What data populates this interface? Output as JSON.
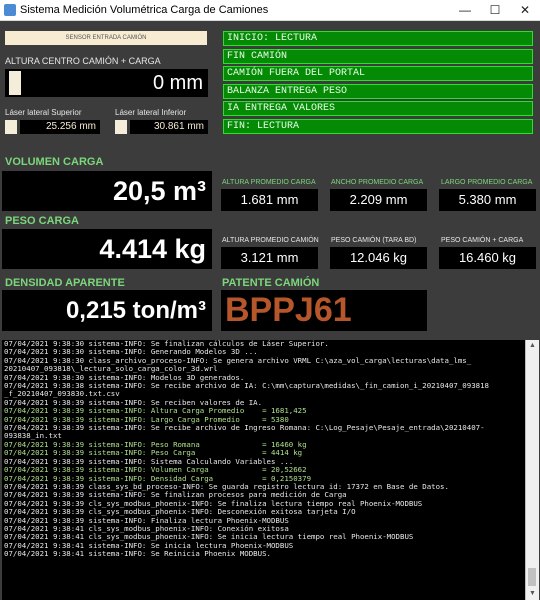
{
  "window": {
    "title": "Sistema Medición Volumétrica Carga de Camiones",
    "minimize": "—",
    "maximize": "☐",
    "close": "✕"
  },
  "sensor": {
    "entrada_label": "SENSOR ENTRADA CAMIÓN"
  },
  "altura": {
    "label": "ALTURA CENTRO CAMIÓN + CARGA",
    "value": "0 mm"
  },
  "laser": {
    "superior_label": "Láser lateral Superior",
    "superior_value": "25.256 mm",
    "inferior_label": "Láser lateral Inferior",
    "inferior_value": "30.861 mm"
  },
  "status": {
    "items": [
      "INICIO: LECTURA",
      "FIN CAMIÓN",
      "CAMIÓN FUERA DEL PORTAL",
      "BALANZA ENTREGA PESO",
      "IA ENTREGA VALORES",
      "FIN: LECTURA"
    ],
    "color": "#058a05"
  },
  "volumen": {
    "label": "VOLUMEN CARGA",
    "value": "20,5 m³"
  },
  "peso": {
    "label": "PESO CARGA",
    "value": "4.414 kg"
  },
  "densidad": {
    "label": "DENSIDAD APARENTE",
    "value": "0,215 ton/m³"
  },
  "patente": {
    "label": "PATENTE CAMIÓN",
    "value": "BPPJ61",
    "color": "#b5572b"
  },
  "metrics": {
    "altura_carga_label": "ALTURA PROMEDIO CARGA",
    "altura_carga_value": "1.681 mm",
    "ancho_carga_label": "ANCHO PROMEDIO CARGA",
    "ancho_carga_value": "2.209 mm",
    "largo_carga_label": "LARGO PROMEDIO CARGA",
    "largo_carga_value": "5.380 mm",
    "altura_camion_label": "ALTURA PROMEDIO CAMIÓN",
    "altura_camion_value": "3.121 mm",
    "peso_tara_label": "PESO CAMIÓN (TARA BD)",
    "peso_tara_value": "12.046 kg",
    "peso_total_label": "PESO CAMIÓN + CARGA",
    "peso_total_value": "16.460 kg"
  },
  "log": {
    "lines": [
      {
        "text": "07/04/2021 9:38:30 sistema-INFO: Se finalizan cálculos de Láser Superior.",
        "g": false
      },
      {
        "text": "07/04/2021 9:38:30 sistema-INFO: Generando Modelos 3D ...",
        "g": false
      },
      {
        "text": "07/04/2021 9:38:30 class_archivo_proceso-INFO: Se genera archivo VRML C:\\aza_vol_carga\\lecturas\\data_lms_",
        "g": false
      },
      {
        "text": "20210407_093818\\_lectura_solo_carga_color_3d.wrl",
        "g": false
      },
      {
        "text": "07/04/2021 9:38:30 sistema-INFO: Modelos 3D generados.",
        "g": false
      },
      {
        "text": "07/04/2021 9:38:38 sistema-INFO: Se recibe archivo de IA: C:\\mm\\captura\\medidas\\_fin_camion_i_20210407_093818",
        "g": false
      },
      {
        "text": "_f_20210407_093830.txt.csv",
        "g": false
      },
      {
        "text": "07/04/2021 9:38:39 sistema-INFO: Se reciben valores de IA.",
        "g": false
      },
      {
        "text": "07/04/2021 9:38:39 sistema-INFO: Altura Carga Promedio    = 1681,425",
        "g": true
      },
      {
        "text": "07/04/2021 9:38:39 sistema-INFO: Largo Carga Promedio     = 5380",
        "g": true
      },
      {
        "text": "07/04/2021 9:38:39 sistema-INFO: Se recibe archivo de Ingreso Romana: C:\\Log_Pesaje\\Pesaje_entrada\\20210407-",
        "g": false
      },
      {
        "text": "093838_in.txt",
        "g": false
      },
      {
        "text": "07/04/2021 9:38:39 sistema-INFO: Peso Romana              = 16460 kg",
        "g": true
      },
      {
        "text": "07/04/2021 9:38:39 sistema-INFO: Peso Carga               = 4414 kg",
        "g": true
      },
      {
        "text": "07/04/2021 9:38:39 sistema-INFO: Sistema Calculando Variables ...",
        "g": false
      },
      {
        "text": "07/04/2021 9:38:39 sistema-INFO: Volumen Carga            = 20,52662",
        "g": true
      },
      {
        "text": "07/04/2021 9:38:39 sistema-INFO: Densidad Carga           = 0,2150379",
        "g": true
      },
      {
        "text": "07/04/2021 9:38:39 class_sys_bd_proceso-INFO: Se guarda registro lectura id: 17372 en Base de Datos.",
        "g": false
      },
      {
        "text": "07/04/2021 9:38:39 sistema-INFO: Se finalizan procesos para medición de Carga",
        "g": false
      },
      {
        "text": "07/04/2021 9:38:39 cls_sys_modbus_phoenix-INFO: Se finaliza lectura tiempo real Phoenix-MODBUS",
        "g": false
      },
      {
        "text": "07/04/2021 9:38:39 cls_sys_modbus_phoenix-INFO: Desconexión exitosa tarjeta I/O",
        "g": false
      },
      {
        "text": "07/04/2021 9:38:39 sistema-INFO: Finaliza lectura Phoenix-MODBUS",
        "g": false
      },
      {
        "text": "07/04/2021 9:38:41 cls_sys_modbus_phoenix-INFO: Conexión exitosa",
        "g": false
      },
      {
        "text": "07/04/2021 9:38:41 cls_sys_modbus_phoenix-INFO: Se inicia lectura tiempo real Phoenix-MODBUS",
        "g": false
      },
      {
        "text": "07/04/2021 9:38:41 sistema-INFO: Se inicia lectura Phoenix-MODBUS",
        "g": false
      },
      {
        "text": "07/04/2021 9:38:41 sistema-INFO: Se Reinicia Phoenix MODBUS.",
        "g": false
      }
    ]
  }
}
